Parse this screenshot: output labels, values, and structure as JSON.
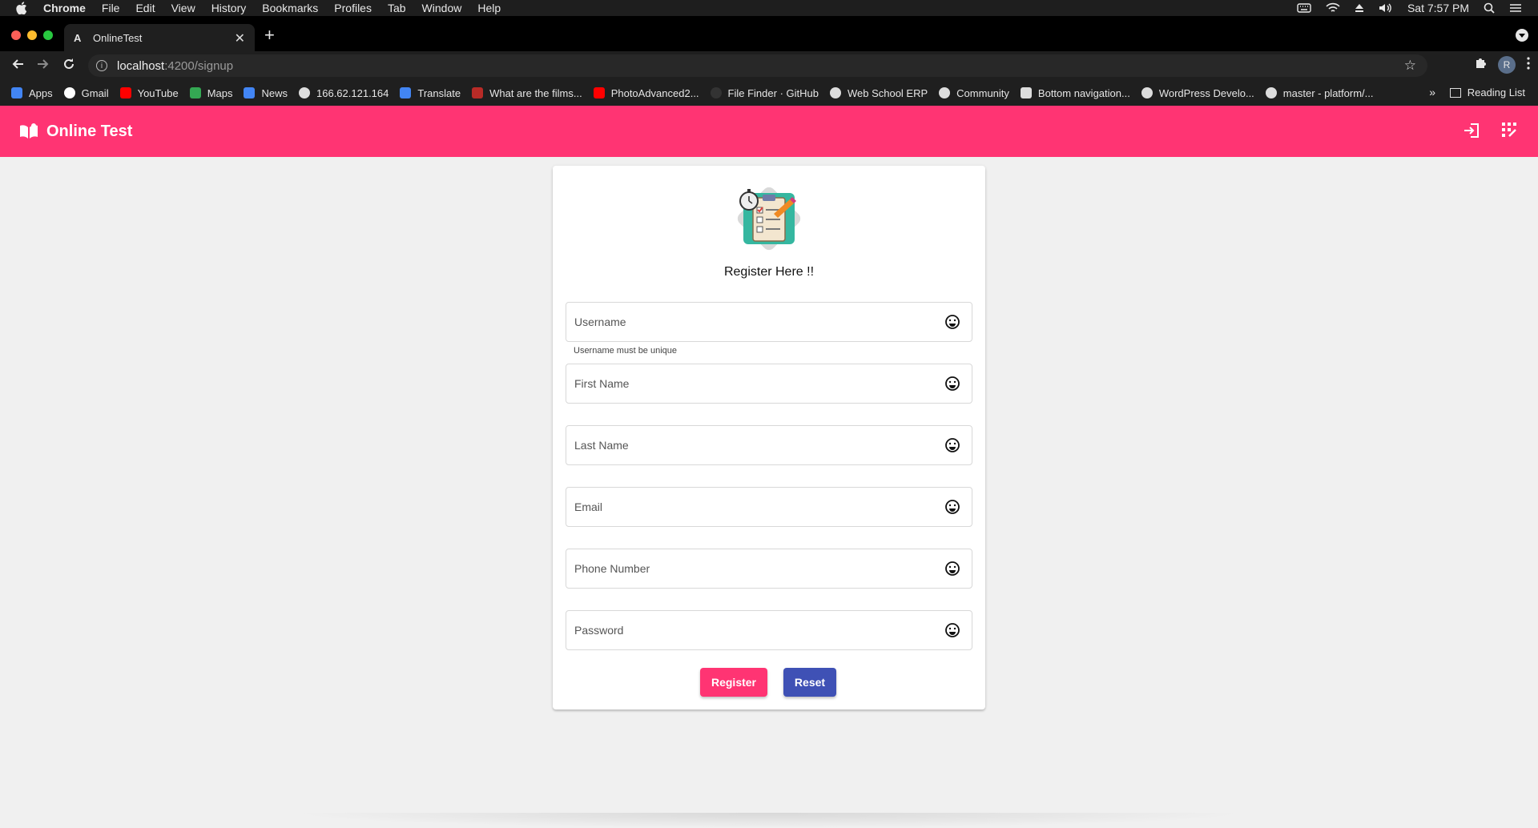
{
  "menubar": {
    "app": "Chrome",
    "items": [
      "File",
      "Edit",
      "View",
      "History",
      "Bookmarks",
      "Profiles",
      "Tab",
      "Window",
      "Help"
    ],
    "clock": "Sat 7:57 PM"
  },
  "browser": {
    "tab_title": "OnlineTest",
    "tab_favicon": "A",
    "url_host": "localhost",
    "url_path": ":4200/signup",
    "profile_initial": "R",
    "bookmarks": [
      {
        "label": "Apps",
        "icon": "apps-grid-icon",
        "color": "#4285f4"
      },
      {
        "label": "Gmail",
        "icon": "google-icon",
        "color": "#ffffff"
      },
      {
        "label": "YouTube",
        "icon": "youtube-icon",
        "color": "#ff0000"
      },
      {
        "label": "Maps",
        "icon": "maps-icon",
        "color": "#34a853"
      },
      {
        "label": "News",
        "icon": "news-icon",
        "color": "#4285f4"
      },
      {
        "label": "166.62.121.164",
        "icon": "globe-icon",
        "color": "#dddddd"
      },
      {
        "label": "Translate",
        "icon": "translate-icon",
        "color": "#4285f4"
      },
      {
        "label": "What are the films...",
        "icon": "quora-icon",
        "color": "#b92b27"
      },
      {
        "label": "PhotoAdvanced2...",
        "icon": "youtube-icon",
        "color": "#ff0000"
      },
      {
        "label": "File Finder · GitHub",
        "icon": "github-icon",
        "color": "#333333"
      },
      {
        "label": "Web School ERP",
        "icon": "globe-icon",
        "color": "#dddddd"
      },
      {
        "label": "Community",
        "icon": "globe-icon",
        "color": "#dddddd"
      },
      {
        "label": "Bottom navigation...",
        "icon": "bookmark-page-icon",
        "color": "#dddddd"
      },
      {
        "label": "WordPress Develo...",
        "icon": "wordpress-icon",
        "color": "#dddddd"
      },
      {
        "label": "master - platform/...",
        "icon": "globe-icon",
        "color": "#dddddd"
      }
    ],
    "more": "»",
    "reading_list": "Reading List"
  },
  "app": {
    "title": "Online Test",
    "accent": "#ff3473",
    "secondary": "#3f51b5"
  },
  "form": {
    "heading": "Register Here !!",
    "fields": [
      {
        "placeholder": "Username",
        "value": ""
      },
      {
        "placeholder": "First Name",
        "value": ""
      },
      {
        "placeholder": "Last Name",
        "value": ""
      },
      {
        "placeholder": "Email",
        "value": ""
      },
      {
        "placeholder": "Phone Number",
        "value": ""
      },
      {
        "placeholder": "Password",
        "value": ""
      }
    ],
    "username_hint": "Username must be unique",
    "register_label": "Register",
    "reset_label": "Reset"
  }
}
